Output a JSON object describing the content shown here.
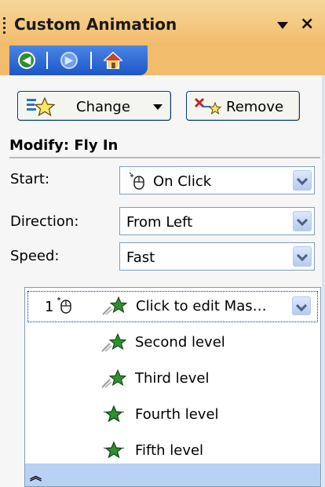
{
  "pane": {
    "title": "Custom Animation",
    "icons": {
      "dropdown": "chevron-down-icon",
      "close": "close-icon",
      "grip": "grip-icon"
    }
  },
  "navbar": {
    "back": "back-arrow-icon",
    "forward": "forward-arrow-icon",
    "home": "home-icon"
  },
  "toolbar": {
    "change_label": "Change",
    "remove_label": "Remove"
  },
  "modify": {
    "title": "Modify: Fly In",
    "fields": {
      "start": {
        "label": "Start:",
        "value": "On Click"
      },
      "direction": {
        "label": "Direction:",
        "value": "From Left"
      },
      "speed": {
        "label": "Speed:",
        "value": "Fast"
      }
    }
  },
  "animation_list": {
    "items": [
      {
        "order": "1",
        "text": "Click to edit Mas…",
        "selected": true,
        "trigger": "mouse-click-icon",
        "effect": "fly-in-star-icon"
      },
      {
        "text": "Second level",
        "effect": "fly-in-star-icon"
      },
      {
        "text": "Third level",
        "effect": "fly-in-star-icon"
      },
      {
        "text": "Fourth level",
        "effect": "star-effect-icon"
      },
      {
        "text": "Fifth level",
        "effect": "star-effect-icon"
      }
    ],
    "expand_icon": "double-chevron-up-icon"
  },
  "colors": {
    "title_bar": "#f1bc6b",
    "nav_blue": "#1c56c8",
    "list_footer": "#b9d1f5",
    "combo_border": "#7f9db9"
  }
}
